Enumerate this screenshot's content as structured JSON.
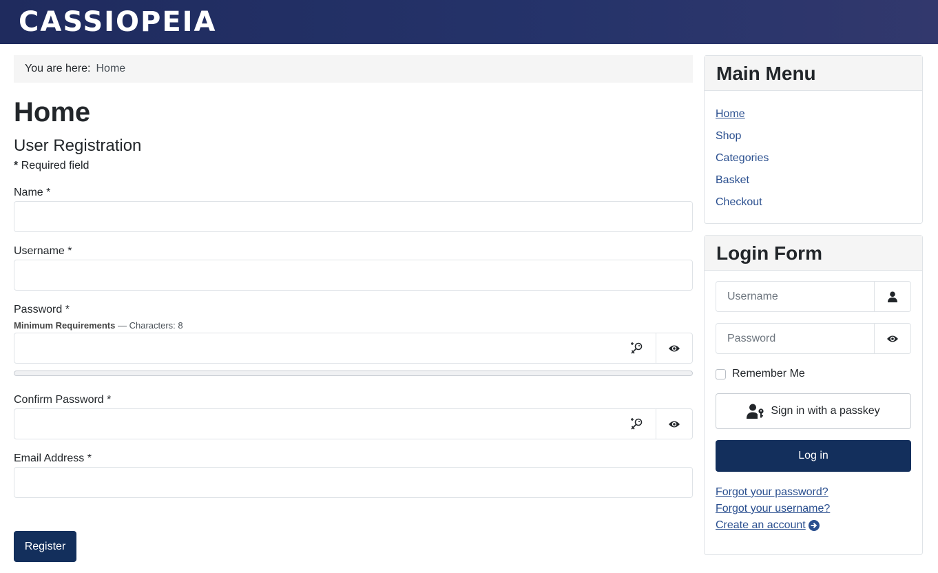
{
  "site": {
    "brand": "CASSIOPEIA"
  },
  "breadcrumb": {
    "label": "You are here:",
    "current": "Home"
  },
  "page": {
    "title": "Home"
  },
  "registration": {
    "title": "User Registration",
    "required_marker": "*",
    "required_note": "Required field",
    "name_label": "Name *",
    "username_label": "Username *",
    "password_label": "Password *",
    "min_req_label": "Minimum Requirements",
    "min_req_detail": "— Characters: 8",
    "confirm_label": "Confirm Password *",
    "email_label": "Email Address *",
    "register_label": "Register",
    "password_strength": 0
  },
  "main_menu": {
    "title": "Main Menu",
    "items": [
      {
        "label": "Home"
      },
      {
        "label": "Shop"
      },
      {
        "label": "Categories"
      },
      {
        "label": "Basket"
      },
      {
        "label": "Checkout"
      }
    ]
  },
  "login_form": {
    "title": "Login Form",
    "username_placeholder": "Username",
    "password_placeholder": "Password",
    "remember_label": "Remember Me",
    "passkey_label": "Sign in with a passkey",
    "login_label": "Log in",
    "forgot_password": "Forgot your password?",
    "forgot_username": "Forgot your username?",
    "create_account": "Create an account"
  },
  "colors": {
    "header": "#1f2b5e",
    "primary_button": "#132f5c",
    "link": "#2a4f8f"
  },
  "icons": [
    "user-icon",
    "eye-icon",
    "key-icon",
    "passkey-icon",
    "arrow-circle-right-icon"
  ]
}
